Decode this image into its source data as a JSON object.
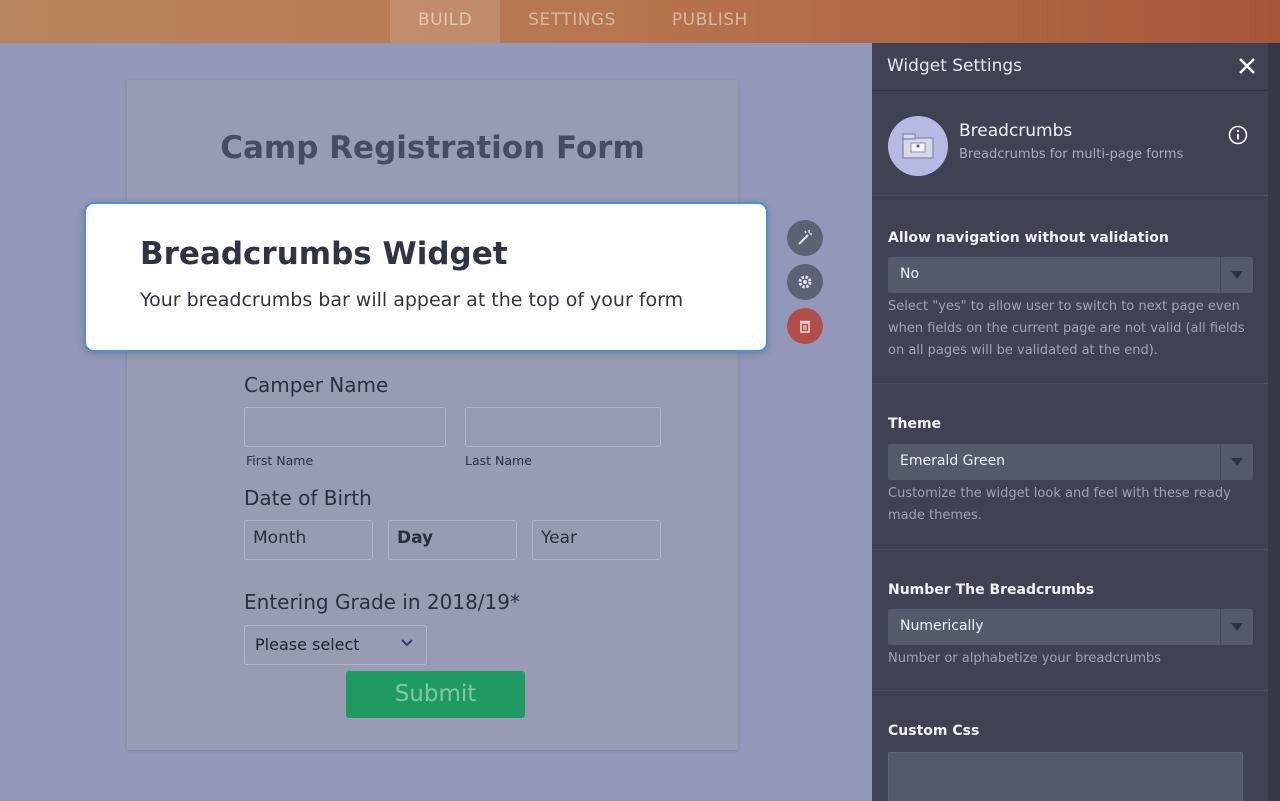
{
  "topbar": {
    "tabs": [
      {
        "label": "BUILD",
        "active": true
      },
      {
        "label": "SETTINGS",
        "active": false
      },
      {
        "label": "PUBLISH",
        "active": false
      }
    ]
  },
  "form": {
    "title": "Camp Registration Form",
    "camper_name_label": "Camper Name",
    "first_name_label": "First Name",
    "last_name_label": "Last Name",
    "dob_label": "Date of Birth",
    "dob_month": "Month",
    "dob_day": "Day",
    "dob_year": "Year",
    "grade_label": "Entering Grade in 2018/19*",
    "grade_select": "Please select",
    "submit_label": "Submit"
  },
  "widget_card": {
    "title": "Breadcrumbs Widget",
    "description": "Your breadcrumbs bar will appear at the top of your form"
  },
  "panel": {
    "title": "Widget Settings",
    "widget_name": "Breadcrumbs",
    "widget_subtitle": "Breadcrumbs for multi-page forms",
    "sections": {
      "navigation": {
        "label": "Allow navigation without validation",
        "value": "No",
        "help": "Select \"yes\" to allow user to switch to next page even when fields on the current page are not valid (all fields on all pages will be validated at the end)."
      },
      "theme": {
        "label": "Theme",
        "value": "Emerald Green",
        "help": "Customize the widget look and feel with these ready made themes."
      },
      "number": {
        "label": "Number The Breadcrumbs",
        "value": "Numerically",
        "help": "Number or alphabetize your breadcrumbs"
      },
      "css": {
        "label": "Custom Css"
      }
    }
  },
  "colors": {
    "accent_blue": "#4a90d9",
    "submit_green": "#1f9a62",
    "delete_red": "#b14e4a",
    "panel_bg": "#3e4252"
  },
  "icons": {
    "wand": "magic-wand-icon",
    "gear": "gear-icon",
    "trash": "trash-icon",
    "close": "close-icon",
    "info": "info-icon",
    "widget": "breadcrumbs-widget-icon",
    "chevron": "chevron-down-icon"
  }
}
